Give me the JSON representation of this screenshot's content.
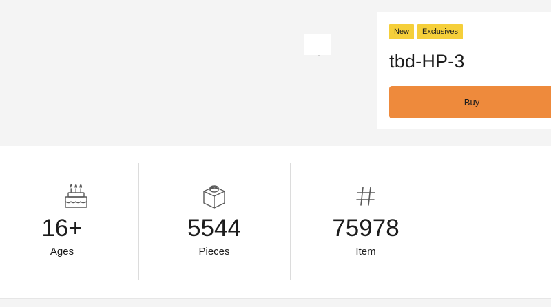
{
  "product": {
    "badges": [
      "New",
      "Exclusives"
    ],
    "title": "tbd-HP-3",
    "buy_label": "Buy"
  },
  "specs": [
    {
      "icon": "cake-icon",
      "value": "16+",
      "label": "Ages"
    },
    {
      "icon": "brick-icon",
      "value": "5544",
      "label": "Pieces"
    },
    {
      "icon": "hash-icon",
      "value": "75978",
      "label": "Item"
    }
  ],
  "colors": {
    "badge": "#f5cf3a",
    "buy_button": "#ee8a3c",
    "hero_background": "#f4f4f4"
  }
}
